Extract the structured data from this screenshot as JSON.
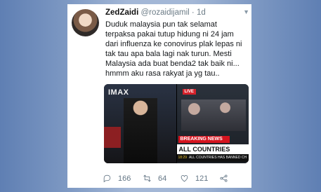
{
  "tweet": {
    "display_name": "ZedZaidi",
    "handle": "@rozaidijamil",
    "separator": "·",
    "timestamp": "1d",
    "text": "Duduk malaysia pun tak selamat\nterpaksa pakai tutup hidung ni 24 jam\ndari influenza ke conovirus plak lepas ni\ntak tau apa bala lagi nak turun. Mesti\nMalaysia ada buat benda2 tak baik ni...\nhmmm aku rasa rakyat ja yg tau..",
    "media": {
      "left_sign": "IMAX",
      "live_badge": "LIVE",
      "breaking_label": "BREAKING NEWS",
      "headline": "ALL COUNTRIES",
      "ticker_time": "18:29",
      "ticker_text": "ALL COUNTRIES HAS BANNED CH"
    },
    "actions": {
      "reply_count": "166",
      "retweet_count": "64",
      "like_count": "121"
    }
  }
}
